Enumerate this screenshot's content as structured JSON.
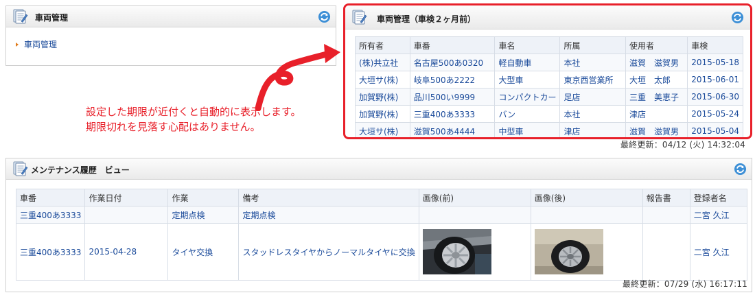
{
  "panel1": {
    "title": "車両管理",
    "tree_item": "車両管理"
  },
  "callout": {
    "line1": "設定した期限が近付くと自動的に表示します。",
    "line2": "期限切れを見落す心配はありません。"
  },
  "panel2": {
    "title": "車両管理（車検２ヶ月前）",
    "columns": [
      "所有者",
      "車番",
      "車名",
      "所属",
      "使用者",
      "車検"
    ],
    "rows": [
      [
        "(株)共立社",
        "名古屋500あ0320",
        "軽自動車",
        "本社",
        "滋賀　滋賀男",
        "2015-05-18"
      ],
      [
        "大垣サ(株)",
        "岐阜500あ2222",
        "大型車",
        "東京西営業所",
        "大垣　太郎",
        "2015-06-01"
      ],
      [
        "加賀野(株)",
        "品川500い9999",
        "コンパクトカー",
        "足店",
        "三重　美恵子",
        "2015-06-30"
      ],
      [
        "加賀野(株)",
        "三重400あ3333",
        "バン",
        "本社",
        "津店",
        "2015-05-24"
      ],
      [
        "大垣サ(株)",
        "滋賀500あ4444",
        "中型車",
        "津店",
        "滋賀　滋賀男",
        "2015-05-04"
      ]
    ],
    "updated": "最終更新：04/12 (火) 14:32:04"
  },
  "panel3": {
    "title": "メンテナンス履歴　ビュー",
    "columns": [
      "車番",
      "作業日付",
      "作業",
      "備考",
      "画像(前)",
      "画像(後)",
      "報告書",
      "登録者名"
    ],
    "rows": [
      [
        "三重400あ3333",
        "",
        "定期点検",
        "定期点検",
        "",
        "",
        "",
        "二宮 久江"
      ],
      [
        "三重400あ3333",
        "2015-04-28",
        "タイヤ交換",
        "スタッドレスタイヤからノーマルタイヤに交換",
        "",
        "",
        "",
        "二宮 久江"
      ]
    ],
    "updated": "最終更新：07/29 (水) 16:17:11"
  },
  "colors": {
    "highlight": "#e8202a",
    "link": "#1a4a9a",
    "header_bg": "#eef2f8"
  }
}
